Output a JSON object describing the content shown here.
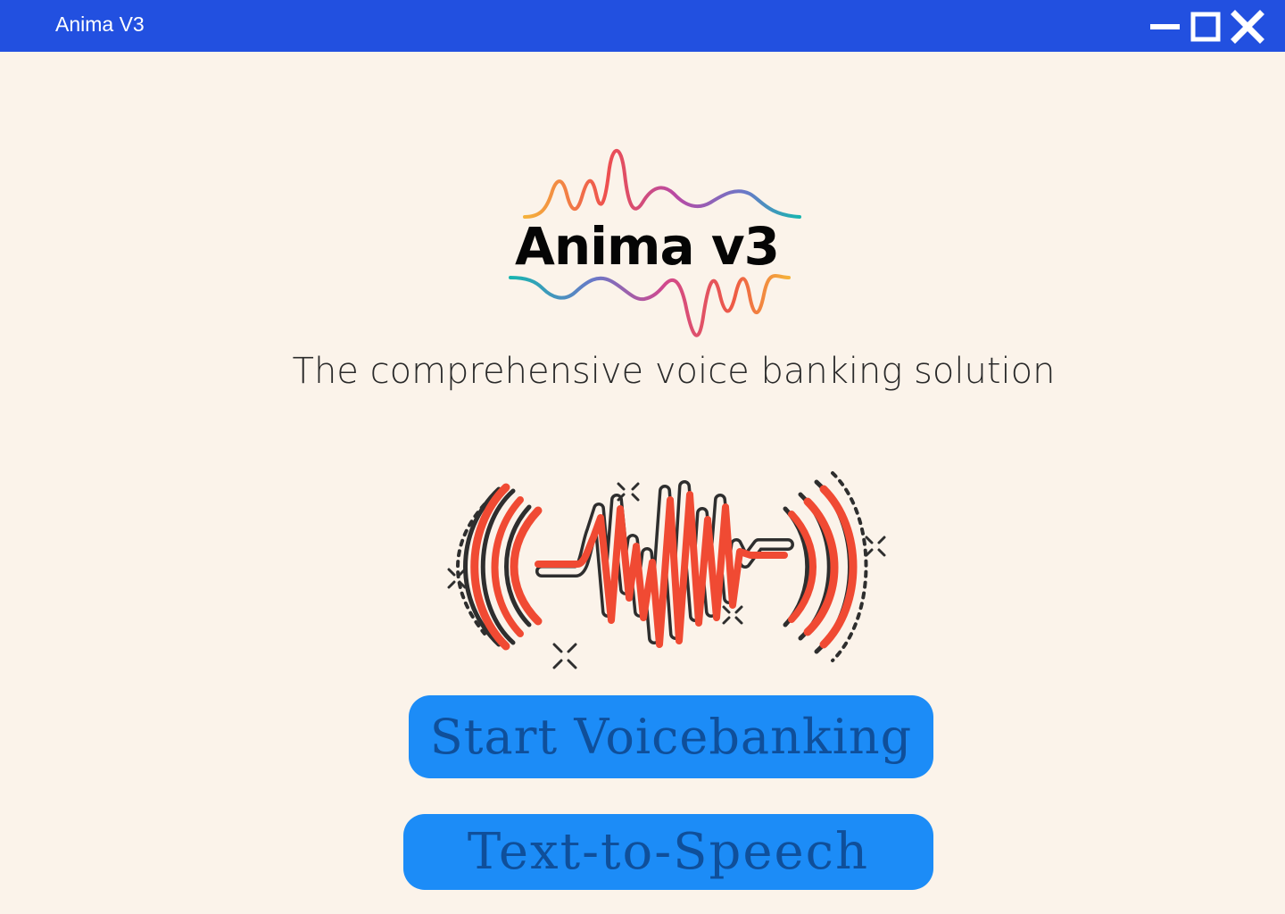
{
  "window": {
    "title": "Anima V3",
    "controls": {
      "minimize_icon": "minimize-icon",
      "maximize_icon": "maximize-icon",
      "close_icon": "close-icon"
    }
  },
  "logo": {
    "text": "Anima v3",
    "icon": "sound-wave-logo"
  },
  "tagline": "The comprehensive voice banking solution",
  "hero_icon": "audio-waveform-illustration",
  "buttons": {
    "start_voicebanking": "Start Voicebanking",
    "text_to_speech": "Text-to-Speech"
  },
  "colors": {
    "titlebar": "#2250e0",
    "background": "#fbf3ea",
    "button": "#1c8cf7",
    "button_text": "#0f4f9a",
    "wave_red": "#f04a33",
    "wave_dark": "#2e2e2e"
  }
}
